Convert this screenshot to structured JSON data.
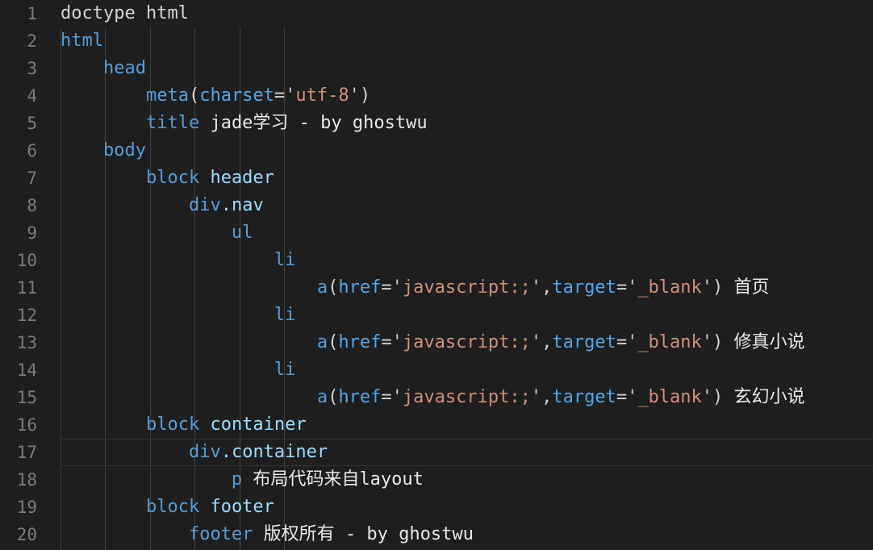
{
  "editor": {
    "language": "jade",
    "theme": "dark",
    "background_color": "#1e1e1e",
    "active_line": 17,
    "first_line": 1,
    "last_line": 20,
    "indent_size": 4,
    "colors": {
      "tag": "#569cd6",
      "name": "#9cdcfe",
      "attribute": "#4fa6e8",
      "string": "#ce9178",
      "quote": "#c8c8c8",
      "plain": "#d4d4d4",
      "text": "#e8e8e8",
      "line_number": "#7a7a7a",
      "indent_guide": "#404040",
      "active_line_border": "#333538"
    }
  },
  "line_numbers": [
    "1",
    "2",
    "3",
    "4",
    "5",
    "6",
    "7",
    "8",
    "9",
    "10",
    "11",
    "12",
    "13",
    "14",
    "15",
    "16",
    "17",
    "18",
    "19",
    "20"
  ],
  "lines": [
    {
      "n": "1",
      "indent": 0,
      "tokens": [
        {
          "t": "plain",
          "v": "doctype html"
        }
      ]
    },
    {
      "n": "2",
      "indent": 0,
      "tokens": [
        {
          "t": "tag",
          "v": "html"
        }
      ]
    },
    {
      "n": "3",
      "indent": 1,
      "tokens": [
        {
          "t": "tag",
          "v": "head"
        }
      ]
    },
    {
      "n": "4",
      "indent": 2,
      "tokens": [
        {
          "t": "tag",
          "v": "meta"
        },
        {
          "t": "punc",
          "v": "("
        },
        {
          "t": "attr",
          "v": "charset"
        },
        {
          "t": "eq",
          "v": "="
        },
        {
          "t": "quote",
          "v": "'"
        },
        {
          "t": "str",
          "v": "utf-8"
        },
        {
          "t": "quote",
          "v": "'"
        },
        {
          "t": "punc",
          "v": ")"
        }
      ]
    },
    {
      "n": "5",
      "indent": 2,
      "tokens": [
        {
          "t": "tag",
          "v": "title"
        },
        {
          "t": "text",
          "v": " jade学习 - by ghostwu"
        }
      ]
    },
    {
      "n": "6",
      "indent": 1,
      "tokens": [
        {
          "t": "tag",
          "v": "body"
        }
      ]
    },
    {
      "n": "7",
      "indent": 2,
      "tokens": [
        {
          "t": "tag",
          "v": "block"
        },
        {
          "t": "name",
          "v": " header"
        }
      ]
    },
    {
      "n": "8",
      "indent": 3,
      "tokens": [
        {
          "t": "tag",
          "v": "div"
        },
        {
          "t": "name",
          "v": ".nav"
        }
      ]
    },
    {
      "n": "9",
      "indent": 4,
      "tokens": [
        {
          "t": "tag",
          "v": "ul"
        }
      ]
    },
    {
      "n": "10",
      "indent": 5,
      "tokens": [
        {
          "t": "tag",
          "v": "li"
        }
      ]
    },
    {
      "n": "11",
      "indent": 6,
      "tokens": [
        {
          "t": "tag",
          "v": "a"
        },
        {
          "t": "punc",
          "v": "("
        },
        {
          "t": "attr",
          "v": "href"
        },
        {
          "t": "eq",
          "v": "="
        },
        {
          "t": "quote",
          "v": "'"
        },
        {
          "t": "str",
          "v": "javascript:;"
        },
        {
          "t": "quote",
          "v": "'"
        },
        {
          "t": "punc",
          "v": ","
        },
        {
          "t": "attr",
          "v": "target"
        },
        {
          "t": "eq",
          "v": "="
        },
        {
          "t": "quote",
          "v": "'"
        },
        {
          "t": "str",
          "v": "_blank"
        },
        {
          "t": "quote",
          "v": "'"
        },
        {
          "t": "punc",
          "v": ")"
        },
        {
          "t": "text",
          "v": " 首页"
        }
      ]
    },
    {
      "n": "12",
      "indent": 5,
      "tokens": [
        {
          "t": "tag",
          "v": "li"
        }
      ]
    },
    {
      "n": "13",
      "indent": 6,
      "tokens": [
        {
          "t": "tag",
          "v": "a"
        },
        {
          "t": "punc",
          "v": "("
        },
        {
          "t": "attr",
          "v": "href"
        },
        {
          "t": "eq",
          "v": "="
        },
        {
          "t": "quote",
          "v": "'"
        },
        {
          "t": "str",
          "v": "javascript:;"
        },
        {
          "t": "quote",
          "v": "'"
        },
        {
          "t": "punc",
          "v": ","
        },
        {
          "t": "attr",
          "v": "target"
        },
        {
          "t": "eq",
          "v": "="
        },
        {
          "t": "quote",
          "v": "'"
        },
        {
          "t": "str",
          "v": "_blank"
        },
        {
          "t": "quote",
          "v": "'"
        },
        {
          "t": "punc",
          "v": ")"
        },
        {
          "t": "text",
          "v": " 修真小说"
        }
      ]
    },
    {
      "n": "14",
      "indent": 5,
      "tokens": [
        {
          "t": "tag",
          "v": "li"
        }
      ]
    },
    {
      "n": "15",
      "indent": 6,
      "tokens": [
        {
          "t": "tag",
          "v": "a"
        },
        {
          "t": "punc",
          "v": "("
        },
        {
          "t": "attr",
          "v": "href"
        },
        {
          "t": "eq",
          "v": "="
        },
        {
          "t": "quote",
          "v": "'"
        },
        {
          "t": "str",
          "v": "javascript:;"
        },
        {
          "t": "quote",
          "v": "'"
        },
        {
          "t": "punc",
          "v": ","
        },
        {
          "t": "attr",
          "v": "target"
        },
        {
          "t": "eq",
          "v": "="
        },
        {
          "t": "quote",
          "v": "'"
        },
        {
          "t": "str",
          "v": "_blank"
        },
        {
          "t": "quote",
          "v": "'"
        },
        {
          "t": "punc",
          "v": ")"
        },
        {
          "t": "text",
          "v": " 玄幻小说"
        }
      ]
    },
    {
      "n": "16",
      "indent": 2,
      "tokens": [
        {
          "t": "tag",
          "v": "block"
        },
        {
          "t": "name",
          "v": " container"
        }
      ]
    },
    {
      "n": "17",
      "indent": 3,
      "tokens": [
        {
          "t": "tag",
          "v": "div"
        },
        {
          "t": "name",
          "v": ".container"
        }
      ]
    },
    {
      "n": "18",
      "indent": 4,
      "tokens": [
        {
          "t": "tag",
          "v": "p"
        },
        {
          "t": "text",
          "v": " 布局代码来自layout"
        }
      ]
    },
    {
      "n": "19",
      "indent": 2,
      "tokens": [
        {
          "t": "tag",
          "v": "block"
        },
        {
          "t": "name",
          "v": " footer"
        }
      ]
    },
    {
      "n": "20",
      "indent": 3,
      "tokens": [
        {
          "t": "tag",
          "v": "footer"
        },
        {
          "t": "text",
          "v": " 版权所有 - by ghostwu"
        }
      ]
    }
  ]
}
